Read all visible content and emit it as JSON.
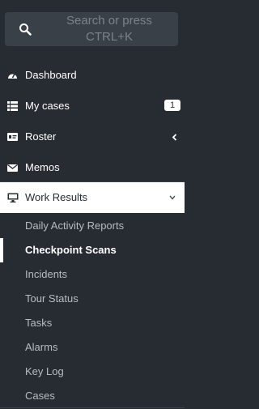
{
  "search": {
    "placeholder_line1": "Search or press",
    "placeholder_line2": "CTRL+K"
  },
  "menu": {
    "dashboard": {
      "label": "Dashboard",
      "icon": "dashboard-icon"
    },
    "my_cases": {
      "label": "My cases",
      "icon": "list-icon",
      "badge": "1"
    },
    "roster": {
      "label": "Roster",
      "icon": "id-card-icon"
    },
    "memos": {
      "label": "Memos",
      "icon": "envelope-icon"
    },
    "work_results": {
      "label": "Work Results",
      "icon": "desktop-icon",
      "expanded": true
    }
  },
  "work_results_items": [
    {
      "label": "Daily Activity Reports"
    },
    {
      "label": "Checkpoint Scans",
      "active": true
    },
    {
      "label": "Incidents"
    },
    {
      "label": "Tour Status"
    },
    {
      "label": "Tasks"
    },
    {
      "label": "Alarms"
    },
    {
      "label": "Key Log"
    },
    {
      "label": "Cases"
    }
  ],
  "colors": {
    "sidebar_bg": "#272c33",
    "search_bg": "#3a4048",
    "text": "#ffffff",
    "sub_text": "#b7bcc1"
  }
}
